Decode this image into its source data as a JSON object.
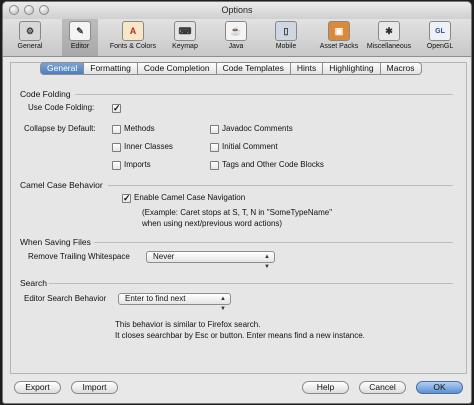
{
  "window": {
    "title": "Options"
  },
  "toolbar": [
    {
      "label": "General",
      "icon": "general-gear-icon",
      "glyph": "⚙"
    },
    {
      "label": "Editor",
      "icon": "editor-icon",
      "glyph": "✎"
    },
    {
      "label": "Fonts & Colors",
      "icon": "fonts-colors-icon",
      "glyph": "A"
    },
    {
      "label": "Keymap",
      "icon": "keymap-icon",
      "glyph": "⌨"
    },
    {
      "label": "Java",
      "icon": "java-icon",
      "glyph": "☕"
    },
    {
      "label": "Mobile",
      "icon": "mobile-icon",
      "glyph": "▯"
    },
    {
      "label": "Asset Packs",
      "icon": "asset-packs-icon",
      "glyph": "▣"
    },
    {
      "label": "Miscellaneous",
      "icon": "miscellaneous-icon",
      "glyph": "✱"
    },
    {
      "label": "OpenGL",
      "icon": "opengl-icon",
      "glyph": "GL"
    }
  ],
  "tabs": [
    "General",
    "Formatting",
    "Code Completion",
    "Code Templates",
    "Hints",
    "Highlighting",
    "Macros"
  ],
  "code_folding": {
    "heading": "Code Folding",
    "use_label": "Use Code Folding:",
    "use_checked": true,
    "collapse_label": "Collapse by Default:",
    "options": [
      {
        "label": "Methods",
        "checked": false
      },
      {
        "label": "Javadoc Comments",
        "checked": false
      },
      {
        "label": "Inner Classes",
        "checked": false
      },
      {
        "label": "Initial Comment",
        "checked": false
      },
      {
        "label": "Imports",
        "checked": false
      },
      {
        "label": "Tags and Other Code Blocks",
        "checked": false
      }
    ]
  },
  "camel_case": {
    "heading": "Camel Case  Behavior",
    "enable_label": "Enable Camel Case Navigation",
    "enable_checked": true,
    "example_line1": "(Example: Caret stops at S, T, N in \"SomeTypeName\"",
    "example_line2": "when using next/previous word actions)"
  },
  "saving": {
    "heading": "When Saving Files",
    "trailing_label": "Remove Trailing Whitespace",
    "trailing_value": "Never"
  },
  "search": {
    "heading": "Search",
    "behavior_label": "Editor Search Behavior",
    "behavior_value": "Enter to find next",
    "note_line1": "This behavior is similar to Firefox search.",
    "note_line2": "It closes searchbar by Esc or button. Enter means find a new instance."
  },
  "buttons": {
    "export": "Export",
    "import": "Import",
    "help": "Help",
    "cancel": "Cancel",
    "ok": "OK"
  },
  "check_glyph": "✓"
}
